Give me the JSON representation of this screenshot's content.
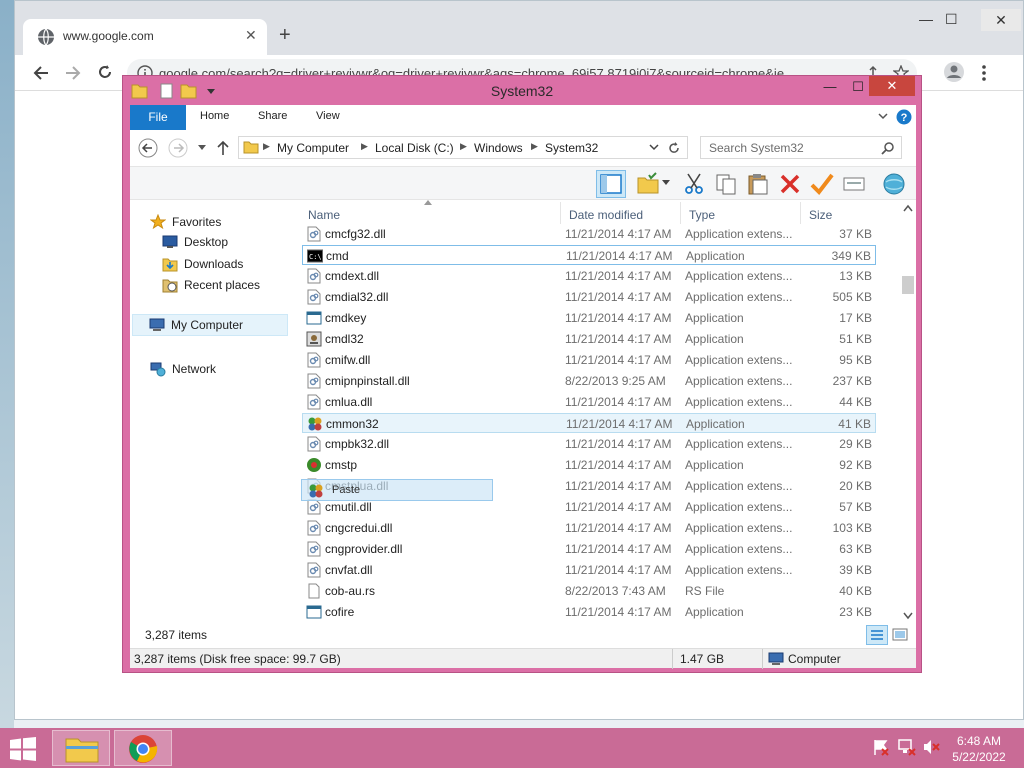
{
  "browser": {
    "tab_title": "www.google.com",
    "tab_close": "✕",
    "new_tab": "+",
    "address": "google.com/search?q=driver+reviywr&oq=driver+reviywr&aqs=chrome..69i57.8719j0j7&sourceid=chrome&ie",
    "minimize": "—",
    "maximize": "☐",
    "close": "✕"
  },
  "explorer": {
    "title": "System32",
    "minimize": "—",
    "maximize": "☐",
    "close": "✕",
    "ribbon_tabs": [
      "File",
      "Home",
      "Share",
      "View"
    ],
    "breadcrumb": [
      "My Computer",
      "Local Disk (C:)",
      "Windows",
      "System32"
    ],
    "search_placeholder": "Search System32",
    "nav": {
      "favorites": "Favorites",
      "desktop": "Desktop",
      "downloads": "Downloads",
      "recent": "Recent places",
      "computer": "My Computer",
      "network": "Network"
    },
    "columns": {
      "name": "Name",
      "date": "Date modified",
      "type": "Type",
      "size": "Size"
    },
    "files": [
      {
        "name": "cmcfg32.dll",
        "date": "11/21/2014 4:17 AM",
        "type": "Application extens...",
        "size": "37 KB",
        "icon": "dll"
      },
      {
        "name": "cmd",
        "date": "11/21/2014 4:17 AM",
        "type": "Application",
        "size": "349 KB",
        "icon": "cmd"
      },
      {
        "name": "cmdext.dll",
        "date": "11/21/2014 4:17 AM",
        "type": "Application extens...",
        "size": "13 KB",
        "icon": "dll"
      },
      {
        "name": "cmdial32.dll",
        "date": "11/21/2014 4:17 AM",
        "type": "Application extens...",
        "size": "505 KB",
        "icon": "dll"
      },
      {
        "name": "cmdkey",
        "date": "11/21/2014 4:17 AM",
        "type": "Application",
        "size": "17 KB",
        "icon": "exe"
      },
      {
        "name": "cmdl32",
        "date": "11/21/2014 4:17 AM",
        "type": "Application",
        "size": "51 KB",
        "icon": "cmdl"
      },
      {
        "name": "cmifw.dll",
        "date": "11/21/2014 4:17 AM",
        "type": "Application extens...",
        "size": "95 KB",
        "icon": "dll"
      },
      {
        "name": "cmipnpinstall.dll",
        "date": "8/22/2013 9:25 AM",
        "type": "Application extens...",
        "size": "237 KB",
        "icon": "dll"
      },
      {
        "name": "cmlua.dll",
        "date": "11/21/2014 4:17 AM",
        "type": "Application extens...",
        "size": "44 KB",
        "icon": "dll"
      },
      {
        "name": "cmmon32",
        "date": "11/21/2014 4:17 AM",
        "type": "Application",
        "size": "41 KB",
        "icon": "mon"
      },
      {
        "name": "cmpbk32.dll",
        "date": "11/21/2014 4:17 AM",
        "type": "Application extens...",
        "size": "29 KB",
        "icon": "dll"
      },
      {
        "name": "cmstp",
        "date": "11/21/2014 4:17 AM",
        "type": "Application",
        "size": "92 KB",
        "icon": "cmstp"
      },
      {
        "name": "cmstplua.dll",
        "date": "11/21/2014 4:17 AM",
        "type": "Application extens...",
        "size": "20 KB",
        "icon": "dll"
      },
      {
        "name": "cmutil.dll",
        "date": "11/21/2014 4:17 AM",
        "type": "Application extens...",
        "size": "57 KB",
        "icon": "dll"
      },
      {
        "name": "cngcredui.dll",
        "date": "11/21/2014 4:17 AM",
        "type": "Application extens...",
        "size": "103 KB",
        "icon": "dll"
      },
      {
        "name": "cngprovider.dll",
        "date": "11/21/2014 4:17 AM",
        "type": "Application extens...",
        "size": "63 KB",
        "icon": "dll"
      },
      {
        "name": "cnvfat.dll",
        "date": "11/21/2014 4:17 AM",
        "type": "Application extens...",
        "size": "39 KB",
        "icon": "dll"
      },
      {
        "name": "cob-au.rs",
        "date": "8/22/2013 7:43 AM",
        "type": "RS File",
        "size": "40 KB",
        "icon": "file"
      },
      {
        "name": "cofire",
        "date": "11/21/2014 4:17 AM",
        "type": "Application",
        "size": "23 KB",
        "icon": "exe"
      }
    ],
    "drag_label": "Paste",
    "item_count": "3,287 items",
    "status_left": "3,287 items (Disk free space: 99.7 GB)",
    "status_size": "1.47 GB",
    "status_location": "Computer"
  },
  "taskbar": {
    "time": "6:48 AM",
    "date": "5/22/2022"
  },
  "colors": {
    "explorer_frame": "#db6fa6",
    "taskbar": "#c96b96",
    "file_tab": "#1979ca",
    "close_button": "#c8463e"
  }
}
